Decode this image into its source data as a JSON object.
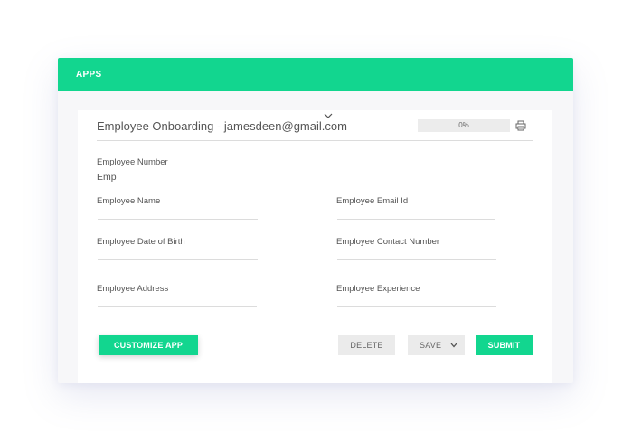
{
  "topbar": {
    "title": "APPS"
  },
  "app": {
    "title": "Employee Onboarding - jamesdeen@gmail.com",
    "progress_label": "0%",
    "progress_value": 0
  },
  "fields": {
    "employee_number": {
      "label": "Employee Number",
      "value": "Emp"
    },
    "employee_name": {
      "label": "Employee Name",
      "value": ""
    },
    "employee_email": {
      "label": "Employee Email Id",
      "value": ""
    },
    "employee_dob": {
      "label": "Employee Date of Birth",
      "value": ""
    },
    "employee_contact": {
      "label": "Employee Contact Number",
      "value": ""
    },
    "employee_address": {
      "label": "Employee Address",
      "value": ""
    },
    "employee_experience": {
      "label": "Employee Experience",
      "value": ""
    }
  },
  "actions": {
    "customize": "CUSTOMIZE APP",
    "delete": "DELETE",
    "save": "SAVE",
    "submit": "SUBMIT"
  },
  "icons": {
    "toggle": "chevron-down-icon",
    "print": "printer-icon",
    "save_menu": "chevron-down-icon"
  },
  "colors": {
    "accent": "#12d68f",
    "topbar_text": "#ffffff",
    "button_grey": "#ebebeb"
  }
}
